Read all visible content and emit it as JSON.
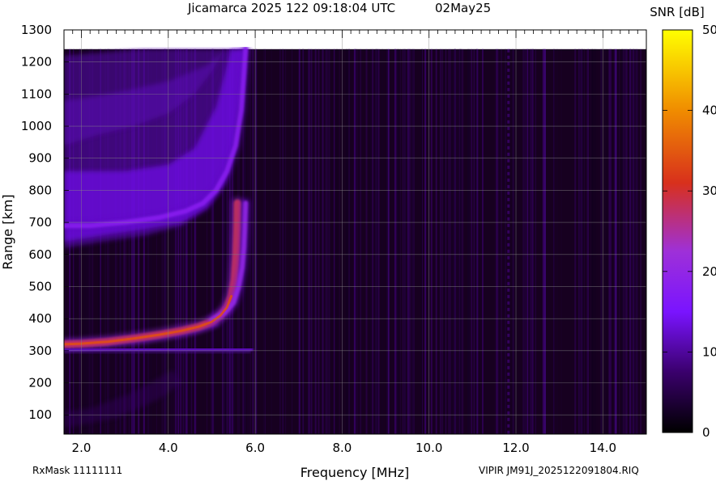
{
  "header": {
    "title": "Jicamarca 2025 122 09:18:04 UTC",
    "date": "02May25"
  },
  "footer": {
    "rx_mask": "RxMask 11111111",
    "file_label": "VIPIR  JM91J_2025122091804.RIQ"
  },
  "chart_data": {
    "type": "heatmap",
    "title": "Jicamarca 2025 122 09:18:04 UTC",
    "xlabel": "Frequency [MHz]",
    "ylabel": "Range [km]",
    "xlim": [
      1.6,
      15.0
    ],
    "ylim": [
      40,
      1300
    ],
    "x_ticks": [
      2.0,
      4.0,
      6.0,
      8.0,
      10.0,
      12.0,
      14.0
    ],
    "x_tick_labels": [
      "2.0",
      "4.0",
      "6.0",
      "8.0",
      "10.0",
      "12.0",
      "14.0"
    ],
    "y_ticks": [
      100,
      200,
      300,
      400,
      500,
      600,
      700,
      800,
      900,
      1000,
      1100,
      1200,
      1300
    ],
    "y_tick_labels": [
      "100",
      "200",
      "300",
      "400",
      "500",
      "600",
      "700",
      "800",
      "900",
      "1000",
      "1100",
      "1200",
      "1300"
    ],
    "data_range_max_km": 1240,
    "grid": true,
    "colorbar": {
      "label": "SNR [dB]",
      "range": [
        0,
        50
      ],
      "ticks": [
        0,
        10,
        20,
        30,
        40,
        50
      ],
      "tick_labels": [
        "0",
        "10",
        "20",
        "30",
        "40",
        "50"
      ],
      "colors": [
        "#000000",
        "#3a006c",
        "#7a14ff",
        "#9e30d8",
        "#d8301c",
        "#f08c00",
        "#ffff00"
      ]
    },
    "traces": [
      {
        "name": "",
        "kind": "O-mode F-trace",
        "points": [
          [
            1.6,
            320
          ],
          [
            2.0,
            322
          ],
          [
            2.6,
            328
          ],
          [
            3.2,
            338
          ],
          [
            3.8,
            350
          ],
          [
            4.3,
            362
          ],
          [
            4.7,
            375
          ],
          [
            5.0,
            390
          ],
          [
            5.2,
            410
          ],
          [
            5.35,
            435
          ],
          [
            5.45,
            470
          ],
          [
            5.52,
            520
          ],
          [
            5.56,
            600
          ],
          [
            5.58,
            680
          ],
          [
            5.59,
            760
          ]
        ],
        "snr_db": 28
      },
      {
        "name": "",
        "kind": "X-mode F-trace",
        "points": [
          [
            5.0,
            395
          ],
          [
            5.3,
            420
          ],
          [
            5.5,
            450
          ],
          [
            5.62,
            500
          ],
          [
            5.7,
            560
          ],
          [
            5.74,
            620
          ],
          [
            5.76,
            680
          ],
          [
            5.78,
            760
          ]
        ],
        "snr_db": 20
      },
      {
        "name": "",
        "kind": "second-hop F-trace",
        "points": [
          [
            1.6,
            690
          ],
          [
            2.2,
            690
          ],
          [
            3.0,
            700
          ],
          [
            3.8,
            715
          ],
          [
            4.4,
            735
          ],
          [
            4.8,
            760
          ],
          [
            5.1,
            800
          ],
          [
            5.35,
            860
          ],
          [
            5.55,
            940
          ],
          [
            5.68,
            1050
          ],
          [
            5.74,
            1160
          ],
          [
            5.78,
            1240
          ]
        ],
        "snr_db": 18
      },
      {
        "name": "",
        "kind": "E-layer echo",
        "points": [
          [
            1.6,
            300
          ],
          [
            2.5,
            302
          ],
          [
            3.5,
            304
          ],
          [
            4.5,
            305
          ],
          [
            5.3,
            305
          ],
          [
            5.9,
            305
          ]
        ],
        "snr_db": 12
      }
    ]
  }
}
